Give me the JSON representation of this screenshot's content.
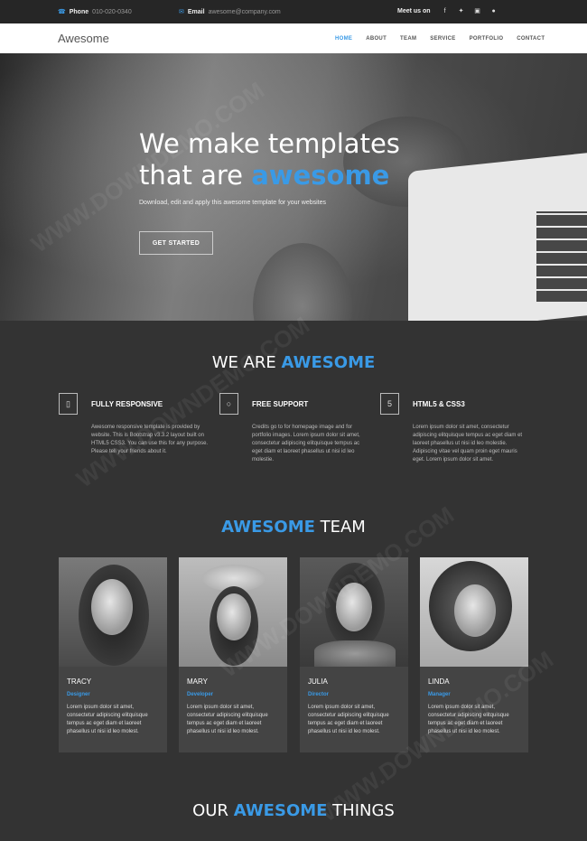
{
  "topbar": {
    "phone_label": "Phone",
    "phone_value": "010-020-0340",
    "email_label": "Email",
    "email_value": "awesome@company.com",
    "social_label": "Meet us on",
    "social_icons": [
      "facebook-icon",
      "twitter-icon",
      "instagram-icon",
      "apple-icon"
    ]
  },
  "nav": {
    "brand": "Awesome",
    "items": [
      "HOME",
      "ABOUT",
      "TEAM",
      "SERVICE",
      "PORTFOLIO",
      "CONTACT"
    ],
    "active": "HOME"
  },
  "hero": {
    "line1": "We make templates",
    "line2_plain": "that are ",
    "line2_highlight": "awesome",
    "subtitle": "Download, edit and apply this awesome template for your websites",
    "button": "GET STARTED"
  },
  "about": {
    "title_plain": "WE ARE ",
    "title_highlight": "AWESOME",
    "features": [
      {
        "icon": "mobile-icon",
        "title": "FULLY RESPONSIVE",
        "text": "Awesome responsive template is provided by website. This is Bootstrap v3.3.2 layout built on HTML5 CSS3. You can use this for any purpose. Please tell your friends about it."
      },
      {
        "icon": "chat-icon",
        "title": "FREE SUPPORT",
        "text": "Credits go to for homepage image and for portfolio images. Lorem ipsum dolor sit amet, consectetur adipiscing elitquisque tempus ac eget diam et laoreet phasellus ut nisi id leo molestie."
      },
      {
        "icon": "html5-icon",
        "title": "HTML5 & CSS3",
        "text": "Lorem ipsum dolor sit amet, consectetur adipiscing elitquisque tempus ac eget diam et laoreet phasellus ut nisi id leo molestie. Adipiscing vitae vel quam proin eget mauris eget. Lorem ipsum dolor sit amet."
      }
    ]
  },
  "team": {
    "title_highlight": "AWESOME",
    "title_plain": " TEAM",
    "members": [
      {
        "name": "TRACY",
        "role": "Designer",
        "text": "Lorem ipsum dolor sit amet, consectetur adipiscing elitquisque tempus ac eget diam et laoreet phasellus ut nisi id leo molest."
      },
      {
        "name": "MARY",
        "role": "Developer",
        "text": "Lorem ipsum dolor sit amet, consectetur adipiscing elitquisque tempus ac eget diam et laoreet phasellus ut nisi id leo molest."
      },
      {
        "name": "JULIA",
        "role": "Director",
        "text": "Lorem ipsum dolor sit amet, consectetur adipiscing elitquisque tempus ac eget diam et laoreet phasellus ut nisi id leo molest."
      },
      {
        "name": "LINDA",
        "role": "Manager",
        "text": "Lorem ipsum dolor sit amet, consectetur adipiscing elitquisque tempus ac eget diam et laoreet phasellus ut nisi id leo molest."
      }
    ]
  },
  "things": {
    "title_plain1": "OUR ",
    "title_highlight": "AWESOME",
    "title_plain2": " THINGS"
  },
  "watermark": "WWW.DOWNDEMO.COM",
  "colors": {
    "accent": "#3a9ae6",
    "background": "#333333",
    "topbar": "#262626",
    "card": "#444444"
  }
}
